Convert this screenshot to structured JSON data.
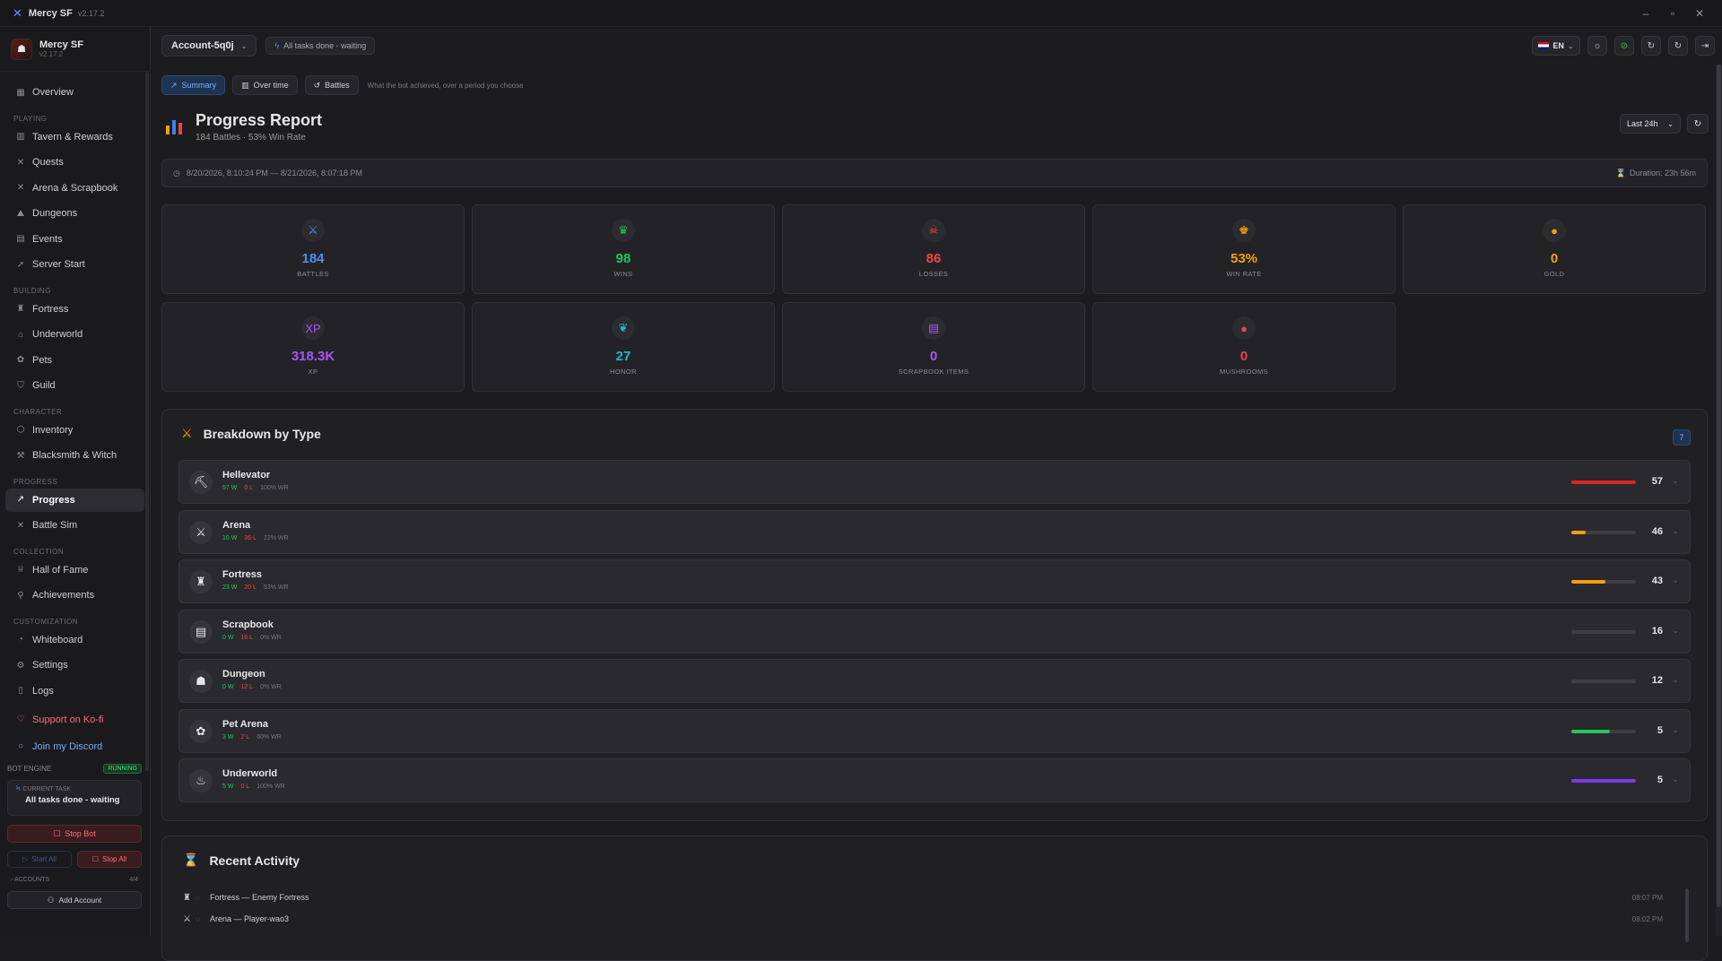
{
  "window": {
    "app": "Mercy SF",
    "version": "v2.17.2"
  },
  "sidebar": {
    "brand": {
      "name": "Mercy SF",
      "version": "v2.17.2"
    },
    "overview": "Overview",
    "sections": {
      "playing": "PLAYING",
      "building": "BUILDING",
      "character": "CHARACTER",
      "progress": "PROGRESS",
      "collection": "COLLECTION",
      "customization": "CUSTOMIZATION"
    },
    "items": {
      "tavern": "Tavern & Rewards",
      "quests": "Quests",
      "arena": "Arena & Scrapbook",
      "dungeons": "Dungeons",
      "events": "Events",
      "server_start": "Server Start",
      "fortress": "Fortress",
      "underworld": "Underworld",
      "pets": "Pets",
      "guild": "Guild",
      "inventory": "Inventory",
      "blacksmith": "Blacksmith & Witch",
      "progress": "Progress",
      "battle_sim": "Battle Sim",
      "hall_of_fame": "Hall of Fame",
      "achievements": "Achievements",
      "whiteboard": "Whiteboard",
      "settings": "Settings",
      "logs": "Logs",
      "kofi": "Support on Ko-fi",
      "discord": "Join my Discord"
    },
    "engine": {
      "label": "BOT ENGINE",
      "status": "RUNNING",
      "current_task_label": "CURRENT TASK",
      "current_task": "All tasks done - waiting",
      "stop_bot": "Stop Bot",
      "start_all": "Start All",
      "stop_all": "Stop All",
      "accounts_label": "ACCOUNTS",
      "accounts_count": "4/4",
      "add_account": "Add Account"
    }
  },
  "topbar": {
    "account": "Account-5q0j",
    "status": "All tasks done - waiting",
    "lang": "EN"
  },
  "tabs": {
    "summary": "Summary",
    "over_time": "Over time",
    "battles": "Battles",
    "hint": "What the bot achieved, over a period you choose"
  },
  "report": {
    "title": "Progress Report",
    "subtitle": "184 Battles · 53% Win Rate",
    "period": "Last 24h",
    "range": "8/20/2026, 8:10:24 PM — 8/21/2026, 8:07:18 PM",
    "duration": "Duration: 23h 56m"
  },
  "stats": [
    {
      "label": "BATTLES",
      "value": "184",
      "color": "#4f8ef7",
      "icon": "⚔"
    },
    {
      "label": "WINS",
      "value": "98",
      "color": "#22c55e",
      "icon": "♛"
    },
    {
      "label": "LOSSES",
      "value": "86",
      "color": "#ef4444",
      "icon": "☠"
    },
    {
      "label": "WIN RATE",
      "value": "53%",
      "color": "#f59e0b",
      "icon": "♚"
    },
    {
      "label": "GOLD",
      "value": "0",
      "color": "#f59e0b",
      "icon": "●"
    },
    {
      "label": "XP",
      "value": "318.3K",
      "color": "#a855f7",
      "icon": "XP"
    },
    {
      "label": "HONOR",
      "value": "27",
      "color": "#22b8cf",
      "icon": "❦"
    },
    {
      "label": "SCRAPBOOK ITEMS",
      "value": "0",
      "color": "#a855f7",
      "icon": "▤"
    },
    {
      "label": "MUSHROOMS",
      "value": "0",
      "color": "#ef4444",
      "icon": "●"
    }
  ],
  "breakdown": {
    "title": "Breakdown by Type",
    "count": "7",
    "rows": [
      {
        "name": "Hellevator",
        "w": "57 W",
        "l": "0 L",
        "wr": "100% WR",
        "count": "57",
        "fill": 1.0,
        "color": "#dc2626",
        "icon": "⛏"
      },
      {
        "name": "Arena",
        "w": "10 W",
        "l": "36 L",
        "wr": "22% WR",
        "count": "46",
        "fill": 0.22,
        "color": "#f59e0b",
        "icon": "⚔"
      },
      {
        "name": "Fortress",
        "w": "23 W",
        "l": "20 L",
        "wr": "53% WR",
        "count": "43",
        "fill": 0.53,
        "color": "#f59e0b",
        "icon": "♜"
      },
      {
        "name": "Scrapbook",
        "w": "0 W",
        "l": "16 L",
        "wr": "0% WR",
        "count": "16",
        "fill": 0.0,
        "color": "#3d3d43",
        "icon": "▤"
      },
      {
        "name": "Dungeon",
        "w": "0 W",
        "l": "12 L",
        "wr": "0% WR",
        "count": "12",
        "fill": 0.0,
        "color": "#3d3d43",
        "icon": "☗"
      },
      {
        "name": "Pet Arena",
        "w": "3 W",
        "l": "2 L",
        "wr": "60% WR",
        "count": "5",
        "fill": 0.6,
        "color": "#22c55e",
        "icon": "✿"
      },
      {
        "name": "Underworld",
        "w": "5 W",
        "l": "0 L",
        "wr": "100% WR",
        "count": "5",
        "fill": 1.0,
        "color": "#7c3aed",
        "icon": "♨"
      }
    ]
  },
  "recent": {
    "title": "Recent Activity",
    "items": [
      {
        "text": "Fortress — Enemy Fortress",
        "time": "08:07 PM",
        "icon": "♜"
      },
      {
        "text": "Arena — Player-wao3",
        "time": "08:02 PM",
        "icon": "⚔"
      }
    ]
  }
}
